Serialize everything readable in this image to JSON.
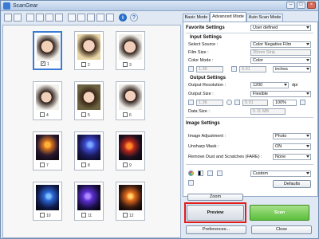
{
  "window": {
    "title": "ScanGear"
  },
  "thumbnails": [
    {
      "num": "1",
      "checked": true
    },
    {
      "num": "2",
      "checked": false
    },
    {
      "num": "3",
      "checked": false
    },
    {
      "num": "4",
      "checked": false
    },
    {
      "num": "5",
      "checked": false
    },
    {
      "num": "6",
      "checked": false
    },
    {
      "num": "7",
      "checked": false
    },
    {
      "num": "8",
      "checked": false
    },
    {
      "num": "9",
      "checked": false
    },
    {
      "num": "10",
      "checked": false
    },
    {
      "num": "11",
      "checked": false
    },
    {
      "num": "12",
      "checked": false
    }
  ],
  "tabs": {
    "basic": "Basic Mode",
    "advanced": "Advanced Mode",
    "auto": "Auto Scan Mode"
  },
  "favorite": {
    "label": "Favorite Settings",
    "value": "User defined"
  },
  "input": {
    "title": "Input Settings",
    "source_label": "Select Source :",
    "source_value": "Color Negative Film",
    "film_label": "Film Size :",
    "film_value": "35mm Strip",
    "color_label": "Color Mode :",
    "color_value": "Color",
    "w": "1.36",
    "h": "0.91",
    "unit": "inches"
  },
  "output": {
    "title": "Output Settings",
    "res_label": "Output Resolution :",
    "res_value": "1200",
    "res_unit": "dpi",
    "size_label": "Output Size :",
    "size_value": "Flexible",
    "w": "1.36",
    "h": "0.91",
    "pct": "100%",
    "data_label": "Data Size :",
    "data_value": "5.11 MB"
  },
  "image": {
    "title": "Image Settings",
    "adj_label": "Image Adjustment :",
    "adj_value": "Photo",
    "unsharp_label": "Unsharp Mask :",
    "unsharp_value": "ON",
    "dust_label": "Remove Dust and Scratches (FARE) :",
    "dust_value": "None"
  },
  "tools": {
    "custom": "Custom",
    "defaults": "Defaults"
  },
  "buttons": {
    "zoom": "Zoom",
    "preview": "Preview",
    "scan": "Scan",
    "preferences": "Preferences...",
    "close": "Close"
  },
  "colors": {
    "accent": "#3a7bd5",
    "scan": "#5bbf3b",
    "highlight": "#e21b1b"
  }
}
